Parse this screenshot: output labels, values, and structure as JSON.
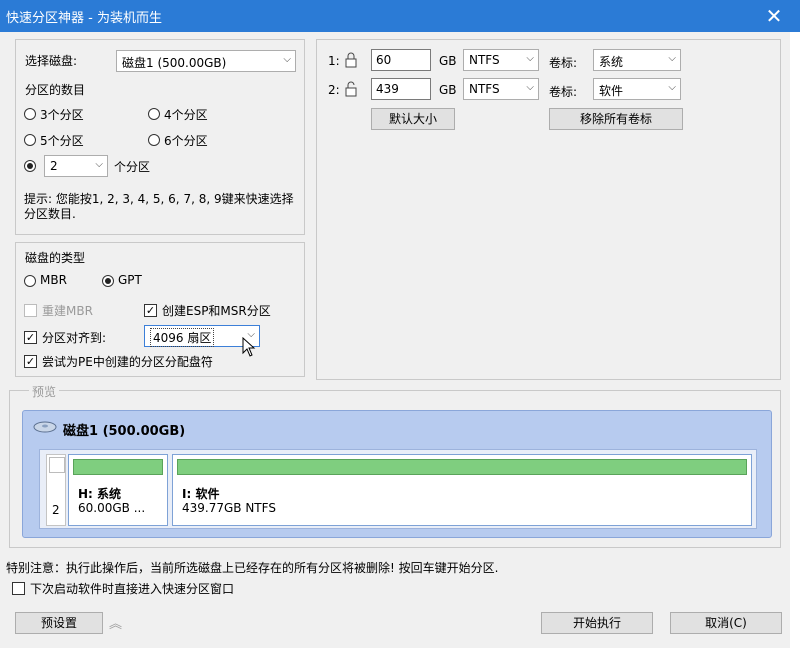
{
  "window": {
    "title": "快速分区神器 - 为装机而生",
    "close": "✕"
  },
  "disk_select": {
    "label": "选择磁盘:",
    "value": "磁盘1 (500.00GB)"
  },
  "partition_count": {
    "label": "分区的数目",
    "options": [
      "3个分区",
      "4个分区",
      "5个分区",
      "6个分区"
    ],
    "custom_value": "2",
    "custom_suffix": "个分区",
    "hint": "提示: 您能按1, 2, 3, 4, 5, 6, 7, 8, 9键来快速选择分区数目."
  },
  "disk_type": {
    "label": "磁盘的类型",
    "mbr": "MBR",
    "gpt": "GPT",
    "rebuild_mbr": "重建MBR",
    "create_esp": "创建ESP和MSR分区",
    "align_label": "分区对齐到:",
    "align_value": "4096 扇区",
    "pe_letter": "尝试为PE中创建的分区分配盘符"
  },
  "partitions": [
    {
      "index": "1:",
      "size": "60",
      "unit": "GB",
      "fs": "NTFS",
      "vol_label": "卷标:",
      "vol_value": "系统"
    },
    {
      "index": "2:",
      "size": "439",
      "unit": "GB",
      "fs": "NTFS",
      "vol_label": "卷标:",
      "vol_value": "软件"
    }
  ],
  "buttons": {
    "default_size": "默认大小",
    "remove_labels": "移除所有卷标",
    "preset": "预设置",
    "start": "开始执行",
    "cancel": "取消(C)"
  },
  "preview": {
    "legend": "预览",
    "disk_title": "磁盘1 (500.00GB)",
    "partition_count_num": "2",
    "part1": {
      "title": "H: 系统",
      "detail": "60.00GB ..."
    },
    "part2": {
      "title": "I: 软件",
      "detail": "439.77GB NTFS"
    }
  },
  "warning": "特别注意：执行此操作后，当前所选磁盘上已经存在的所有分区将被删除! 按回车键开始分区.",
  "next_launch": "下次启动软件时直接进入快速分区窗口",
  "colors": {
    "titlebar": "#2b7bd6",
    "dialog_bg": "#f0f0f0",
    "preview_bg": "#b7cbef",
    "bar_green": "#7fce7f"
  }
}
